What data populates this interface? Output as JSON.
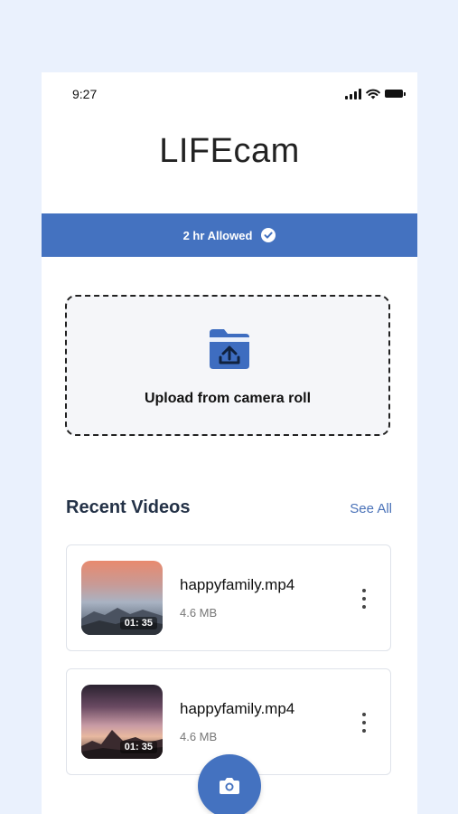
{
  "status_bar": {
    "time": "9:27",
    "icons": [
      "signal-icon",
      "wifi-icon",
      "battery-icon"
    ]
  },
  "app": {
    "title": "LIFEcam"
  },
  "allowance": {
    "text": "2 hr Allowed",
    "icon": "check-circle-icon",
    "color": "#4472c0"
  },
  "upload": {
    "label": "Upload from camera roll",
    "icon": "folder-upload-icon"
  },
  "recent": {
    "title": "Recent Videos",
    "see_all": "See All",
    "videos": [
      {
        "name": "happyfamily.mp4",
        "size": "4.6 MB",
        "duration": "01: 35"
      },
      {
        "name": "happyfamily.mp4",
        "size": "4.6 MB",
        "duration": "01: 35"
      }
    ]
  },
  "fab": {
    "icon": "camera-icon",
    "color": "#4472c0"
  },
  "colors": {
    "background": "#eaf1fd",
    "accent": "#4472c0",
    "link": "#4a72b8"
  }
}
